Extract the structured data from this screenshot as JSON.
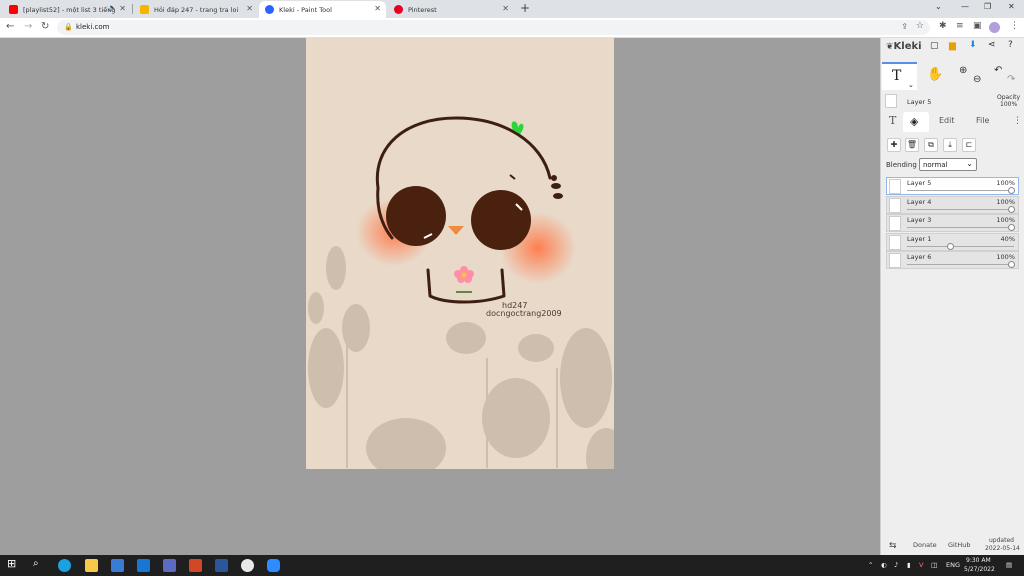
{
  "browser": {
    "tabs": [
      {
        "label": "[playlist52] - một list 3 tiếng",
        "favicon_color": "#ff0000",
        "active": false,
        "audio": true
      },
      {
        "label": "Hỏi đáp 247 - trang tra loi",
        "favicon_color": "#f4b400",
        "active": false,
        "audio": false
      },
      {
        "label": "Kleki - Paint Tool",
        "favicon_color": "#2962ff",
        "active": true,
        "audio": false
      },
      {
        "label": "Pinterest",
        "favicon_color": "#e60023",
        "active": false,
        "audio": false
      }
    ],
    "new_tab_label": "+",
    "url": "kleki.com"
  },
  "canvas": {
    "watermark_line1": "hd247",
    "watermark_line2": "docngoctrang2009"
  },
  "panel": {
    "logo_text": "Kleki",
    "current_layer": "Layer 5",
    "opacity_label": "Opacity",
    "opacity_value": "100%",
    "tabs": [
      "T",
      "layers",
      "Edit",
      "File"
    ],
    "blending_label": "Blending",
    "blending_value": "normal",
    "layers": [
      {
        "name": "Layer 5",
        "opacity": "100%",
        "selected": true,
        "level": 1.0
      },
      {
        "name": "Layer 4",
        "opacity": "100%",
        "selected": false,
        "level": 1.0
      },
      {
        "name": "Layer 3",
        "opacity": "100%",
        "selected": false,
        "level": 1.0
      },
      {
        "name": "Layer 1",
        "opacity": "40%",
        "selected": false,
        "level": 0.4
      },
      {
        "name": "Layer 6",
        "opacity": "100%",
        "selected": false,
        "level": 1.0
      }
    ],
    "footer": {
      "donate": "Donate",
      "github": "GitHub",
      "updated_line1": "updated",
      "updated_line2": "2022-05-14"
    }
  },
  "taskbar": {
    "lang": "ENG",
    "time": "9:30 AM",
    "date": "5/27/2022"
  }
}
